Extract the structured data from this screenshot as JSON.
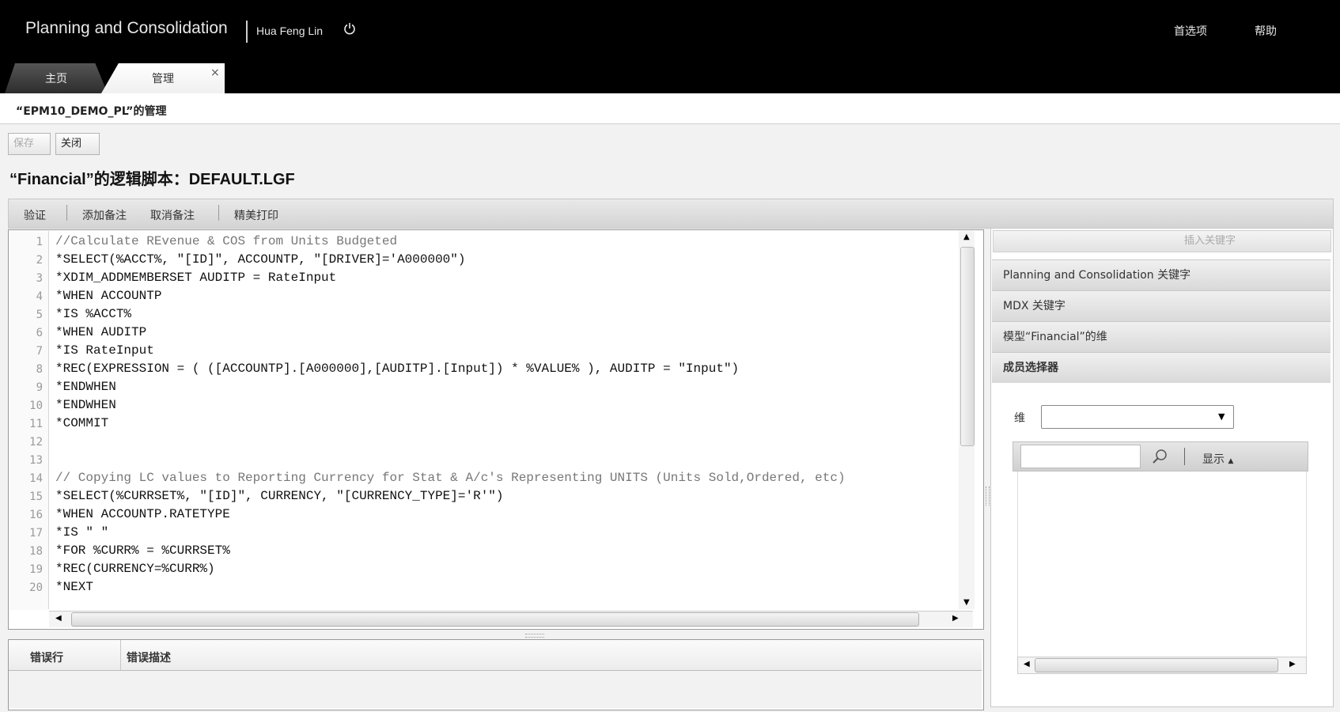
{
  "header": {
    "app_title": "Planning and Consolidation",
    "user": "Hua Feng Lin",
    "preferences": "首选项",
    "help": "帮助"
  },
  "tabs": [
    {
      "label": "主页"
    },
    {
      "label": "管理"
    }
  ],
  "breadcrumb": "“EPM10_DEMO_PL”的管理",
  "actions": {
    "save": "保存",
    "close": "关闭"
  },
  "script_title": "“Financial”的逻辑脚本：DEFAULT.LGF",
  "toolbar": {
    "validate": "验证",
    "add_comment": "添加备注",
    "remove_comment": "取消备注",
    "pretty_print": "精美打印"
  },
  "editor": {
    "line_numbers": [
      "1",
      "2",
      "3",
      "4",
      "5",
      "6",
      "7",
      "8",
      "9",
      "10",
      "11",
      "12",
      "13",
      "14",
      "15",
      "16",
      "17",
      "18",
      "19",
      "20"
    ],
    "lines": [
      "//Calculate REvenue & COS from Units Budgeted",
      "*SELECT(%ACCT%, \"[ID]\", ACCOUNTP, \"[DRIVER]='A000000\")",
      "*XDIM_ADDMEMBERSET AUDITP = RateInput",
      "*WHEN ACCOUNTP",
      "*IS %ACCT%",
      "*WHEN AUDITP",
      "*IS RateInput",
      "*REC(EXPRESSION = ( ([ACCOUNTP].[A000000],[AUDITP].[Input]) * %VALUE% ), AUDITP = \"Input\")",
      "*ENDWHEN",
      "*ENDWHEN",
      "*COMMIT",
      "",
      "",
      "// Copying LC values to Reporting Currency for Stat & A/c's Representing UNITS (Units Sold,Ordered, etc)",
      "*SELECT(%CURRSET%, \"[ID]\", CURRENCY, \"[CURRENCY_TYPE]='R'\")",
      "*WHEN ACCOUNTP.RATETYPE",
      "*IS \" \"",
      "*FOR %CURR% = %CURRSET%",
      "*REC(CURRENCY=%CURR%)",
      "*NEXT"
    ]
  },
  "errors": {
    "col_line": "错误行",
    "col_desc": "错误描述"
  },
  "right_panel": {
    "insert_keyword": "插入关键字",
    "sections": [
      "Planning and Consolidation 关键字",
      "MDX 关键字",
      "模型“Financial”的维",
      "成员选择器"
    ],
    "dimension_label": "维",
    "dimension_value": "",
    "search_value": "",
    "show_label": "显示"
  }
}
